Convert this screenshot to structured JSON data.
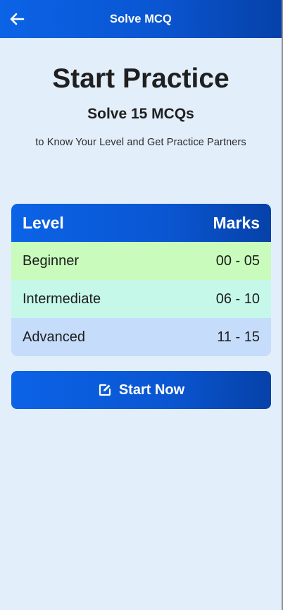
{
  "app_bar": {
    "title": "Solve MCQ",
    "back_icon": "arrow-left-icon"
  },
  "hero": {
    "title": "Start Practice",
    "subtitle": "Solve 15 MCQs",
    "description": "to Know Your Level and Get Practice Partners"
  },
  "levels_table": {
    "headers": {
      "level": "Level",
      "marks": "Marks"
    },
    "rows": [
      {
        "level": "Beginner",
        "marks": "00 - 05",
        "color": "#c8fbbc"
      },
      {
        "level": "Intermediate",
        "marks": "06 - 10",
        "color": "#c5f8e8"
      },
      {
        "level": "Advanced",
        "marks": "11 - 15",
        "color": "#c5dcfb"
      }
    ]
  },
  "start_button": {
    "label": "Start Now",
    "icon": "edit-icon"
  },
  "colors": {
    "primary": "#0a56d2",
    "background": "#e3eefb"
  }
}
